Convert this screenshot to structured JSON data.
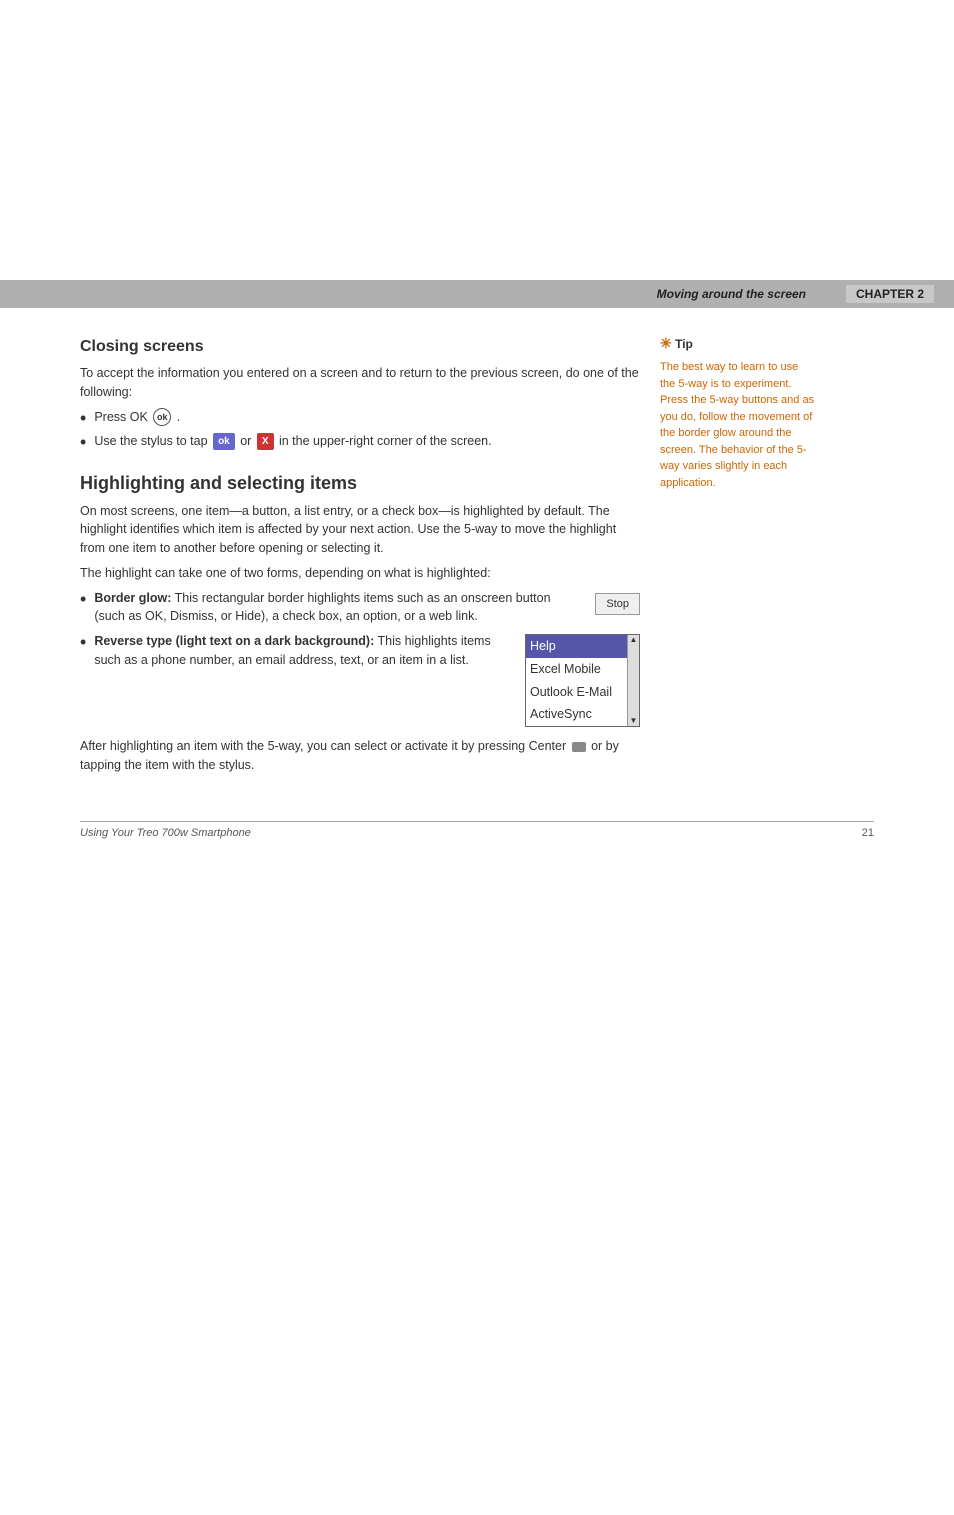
{
  "header": {
    "center_text": "Moving around the screen",
    "chapter_text": "CHAPTER 2"
  },
  "closing_screens": {
    "title": "Closing screens",
    "intro": "To accept the information you entered on a screen and to return to the previous screen, do one of the following:",
    "bullets": [
      {
        "id": "press-ok",
        "text_prefix": "Press OK",
        "text_suffix": "."
      },
      {
        "id": "tap-ok-x",
        "text_prefix": "Use the stylus to tap",
        "ok_label": "ok",
        "or_text": "or",
        "x_label": "X",
        "text_suffix": "in the upper-right corner of the screen."
      }
    ]
  },
  "highlighting": {
    "title": "Highlighting and selecting items",
    "intro": "On most screens, one item—a button, a list entry, or a check box—is highlighted by default. The highlight identifies which item is affected by your next action. Use the 5-way to move the highlight from one item to another before opening or selecting it.",
    "second_para": "The highlight can take one of two forms, depending on what is highlighted:",
    "bullets": [
      {
        "id": "border-glow",
        "label_bold": "Border glow:",
        "text": "This rectangular border highlights items such as an onscreen button (such as OK, Dismiss, or Hide), a check box, an option, or a web link.",
        "button_label": "Stop"
      },
      {
        "id": "reverse-type",
        "label_bold": "Reverse type (light text on a dark background):",
        "text": "This highlights items such as a phone number, an email address, text, or an item in a list.",
        "list_items": [
          {
            "text": "Help",
            "highlighted": true
          },
          {
            "text": "Excel Mobile",
            "highlighted": false
          },
          {
            "text": "Outlook E-Mail",
            "highlighted": false
          },
          {
            "text": "ActiveSync",
            "highlighted": false
          }
        ]
      }
    ],
    "final_para_prefix": "After highlighting an item with the 5-way, you can select or activate it by pressing Center",
    "final_para_suffix": "or by tapping the item with the stylus."
  },
  "tip": {
    "header": "✳ Tip",
    "text": "The best way to learn to use the 5-way is to experiment. Press the 5-way buttons and as you do, follow the movement of the border glow around the screen. The behavior of the 5-way varies slightly in each application."
  },
  "footer": {
    "left": "Using Your Treo 700w Smartphone",
    "right": "21"
  }
}
